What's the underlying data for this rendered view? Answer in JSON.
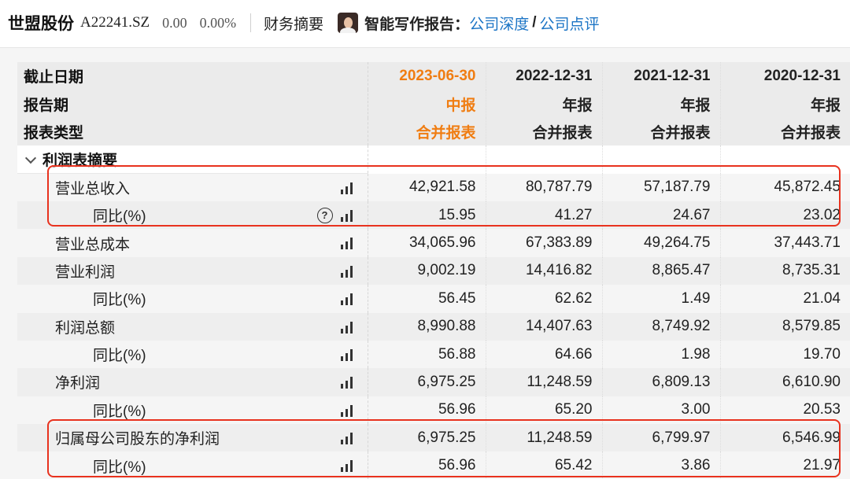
{
  "header": {
    "company_name": "世盟股份",
    "stock_code": "A22241.SZ",
    "price": "0.00",
    "change_pct": "0.00%",
    "section_title": "财务摘要",
    "ai_report_label": "智能写作报告：",
    "link_depth": "公司深度",
    "separator": "/",
    "link_review": "公司点评"
  },
  "table": {
    "header_rows": [
      {
        "label": "截止日期",
        "values": [
          "2023-06-30",
          "2022-12-31",
          "2021-12-31",
          "2020-12-31"
        ]
      },
      {
        "label": "报告期",
        "values": [
          "中报",
          "年报",
          "年报",
          "年报"
        ]
      },
      {
        "label": "报表类型",
        "values": [
          "合并报表",
          "合并报表",
          "合并报表",
          "合并报表"
        ]
      }
    ],
    "section_label": "利润表摘要",
    "rows": [
      {
        "label": "营业总收入",
        "level": 1,
        "help": false,
        "values": [
          "42,921.58",
          "80,787.79",
          "57,187.79",
          "45,872.45"
        ]
      },
      {
        "label": "同比(%)",
        "level": 2,
        "help": true,
        "values": [
          "15.95",
          "41.27",
          "24.67",
          "23.02"
        ]
      },
      {
        "label": "营业总成本",
        "level": 1,
        "help": false,
        "values": [
          "34,065.96",
          "67,383.89",
          "49,264.75",
          "37,443.71"
        ]
      },
      {
        "label": "营业利润",
        "level": 1,
        "help": false,
        "values": [
          "9,002.19",
          "14,416.82",
          "8,865.47",
          "8,735.31"
        ]
      },
      {
        "label": "同比(%)",
        "level": 2,
        "help": false,
        "values": [
          "56.45",
          "62.62",
          "1.49",
          "21.04"
        ]
      },
      {
        "label": "利润总额",
        "level": 1,
        "help": false,
        "values": [
          "8,990.88",
          "14,407.63",
          "8,749.92",
          "8,579.85"
        ]
      },
      {
        "label": "同比(%)",
        "level": 2,
        "help": false,
        "values": [
          "56.88",
          "64.66",
          "1.98",
          "19.70"
        ]
      },
      {
        "label": "净利润",
        "level": 1,
        "help": false,
        "values": [
          "6,975.25",
          "11,248.59",
          "6,809.13",
          "6,610.90"
        ]
      },
      {
        "label": "同比(%)",
        "level": 2,
        "help": false,
        "values": [
          "56.96",
          "65.20",
          "3.00",
          "20.53"
        ]
      },
      {
        "label": "归属母公司股东的净利润",
        "level": 1,
        "help": false,
        "values": [
          "6,975.25",
          "11,248.59",
          "6,799.97",
          "6,546.99"
        ]
      },
      {
        "label": "同比(%)",
        "level": 2,
        "help": false,
        "values": [
          "56.96",
          "65.42",
          "3.86",
          "21.97"
        ]
      }
    ],
    "help_glyph": "?"
  },
  "colors": {
    "accent_orange": "#f07d12",
    "link_blue": "#1b74c5",
    "highlight_red": "#e8321e"
  },
  "icons": {
    "chart": "bar-chart-icon",
    "help": "question-circle-icon",
    "collapse": "chevron-down-icon"
  }
}
